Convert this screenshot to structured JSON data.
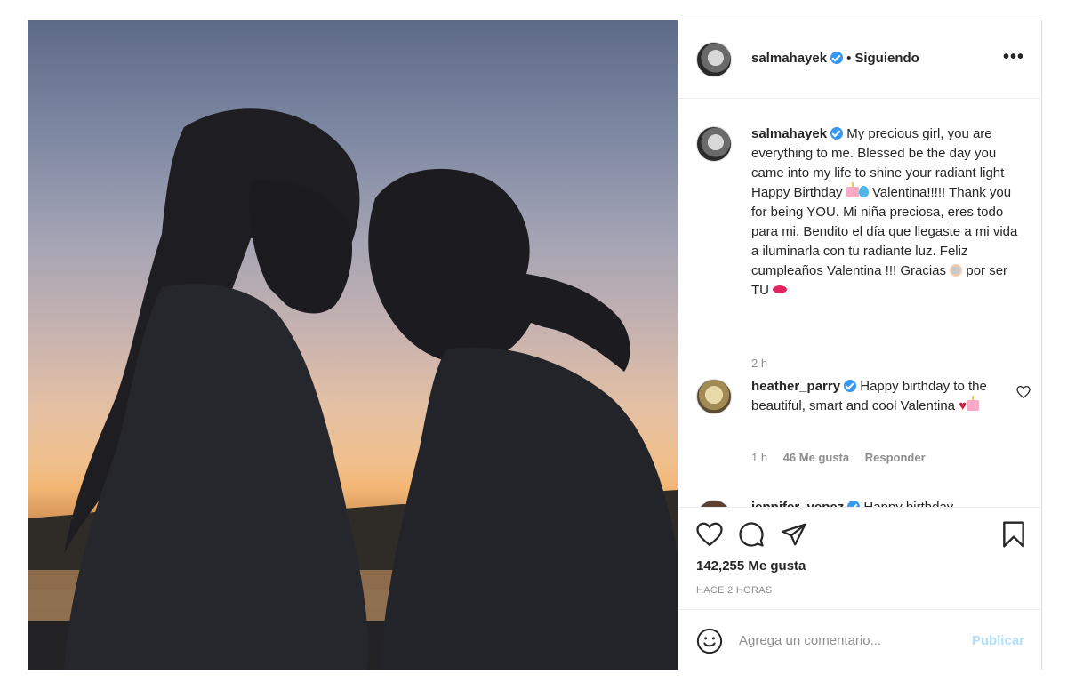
{
  "post": {
    "username": "salmahayek",
    "follow_status": "Siguiendo",
    "more_label": "•••",
    "caption_part1": "My precious girl, you are everything to me. Blessed be the day you came into my life to shine your radiant light Happy Birthday",
    "caption_part2": "Valentina!!!!! Thank you for being YOU. Mi niña preciosa, eres todo para mi. Bendito el día que llegaste a mi vida a iluminarla con tu radiante luz. Feliz cumpleaños Valentina !!! Gracias",
    "caption_part3": "por ser TU",
    "caption_time": "2 h"
  },
  "comments": [
    {
      "username": "heather_parry",
      "text": "Happy birthday to the beautiful, smart and cool Valentina",
      "time": "1 h",
      "likes": "46 Me gusta",
      "reply_label": "Responder"
    },
    {
      "username": "jennifer_yepez",
      "text": "Happy birthday"
    }
  ],
  "actions": {
    "likes_count": "142,255 Me gusta",
    "time_ago": "HACE 2 HORAS"
  },
  "add_comment": {
    "placeholder": "Agrega un comentario...",
    "publish_label": "Publicar"
  },
  "icons": {
    "verified": "verified-badge-icon",
    "like": "heart-icon",
    "comment": "comment-icon",
    "share": "paper-plane-icon",
    "save": "bookmark-icon",
    "emoji": "smiley-icon"
  },
  "colors": {
    "verified_blue": "#3897f0",
    "publish_disabled": "#b2dffc",
    "muted_text": "#8e8e8e"
  }
}
